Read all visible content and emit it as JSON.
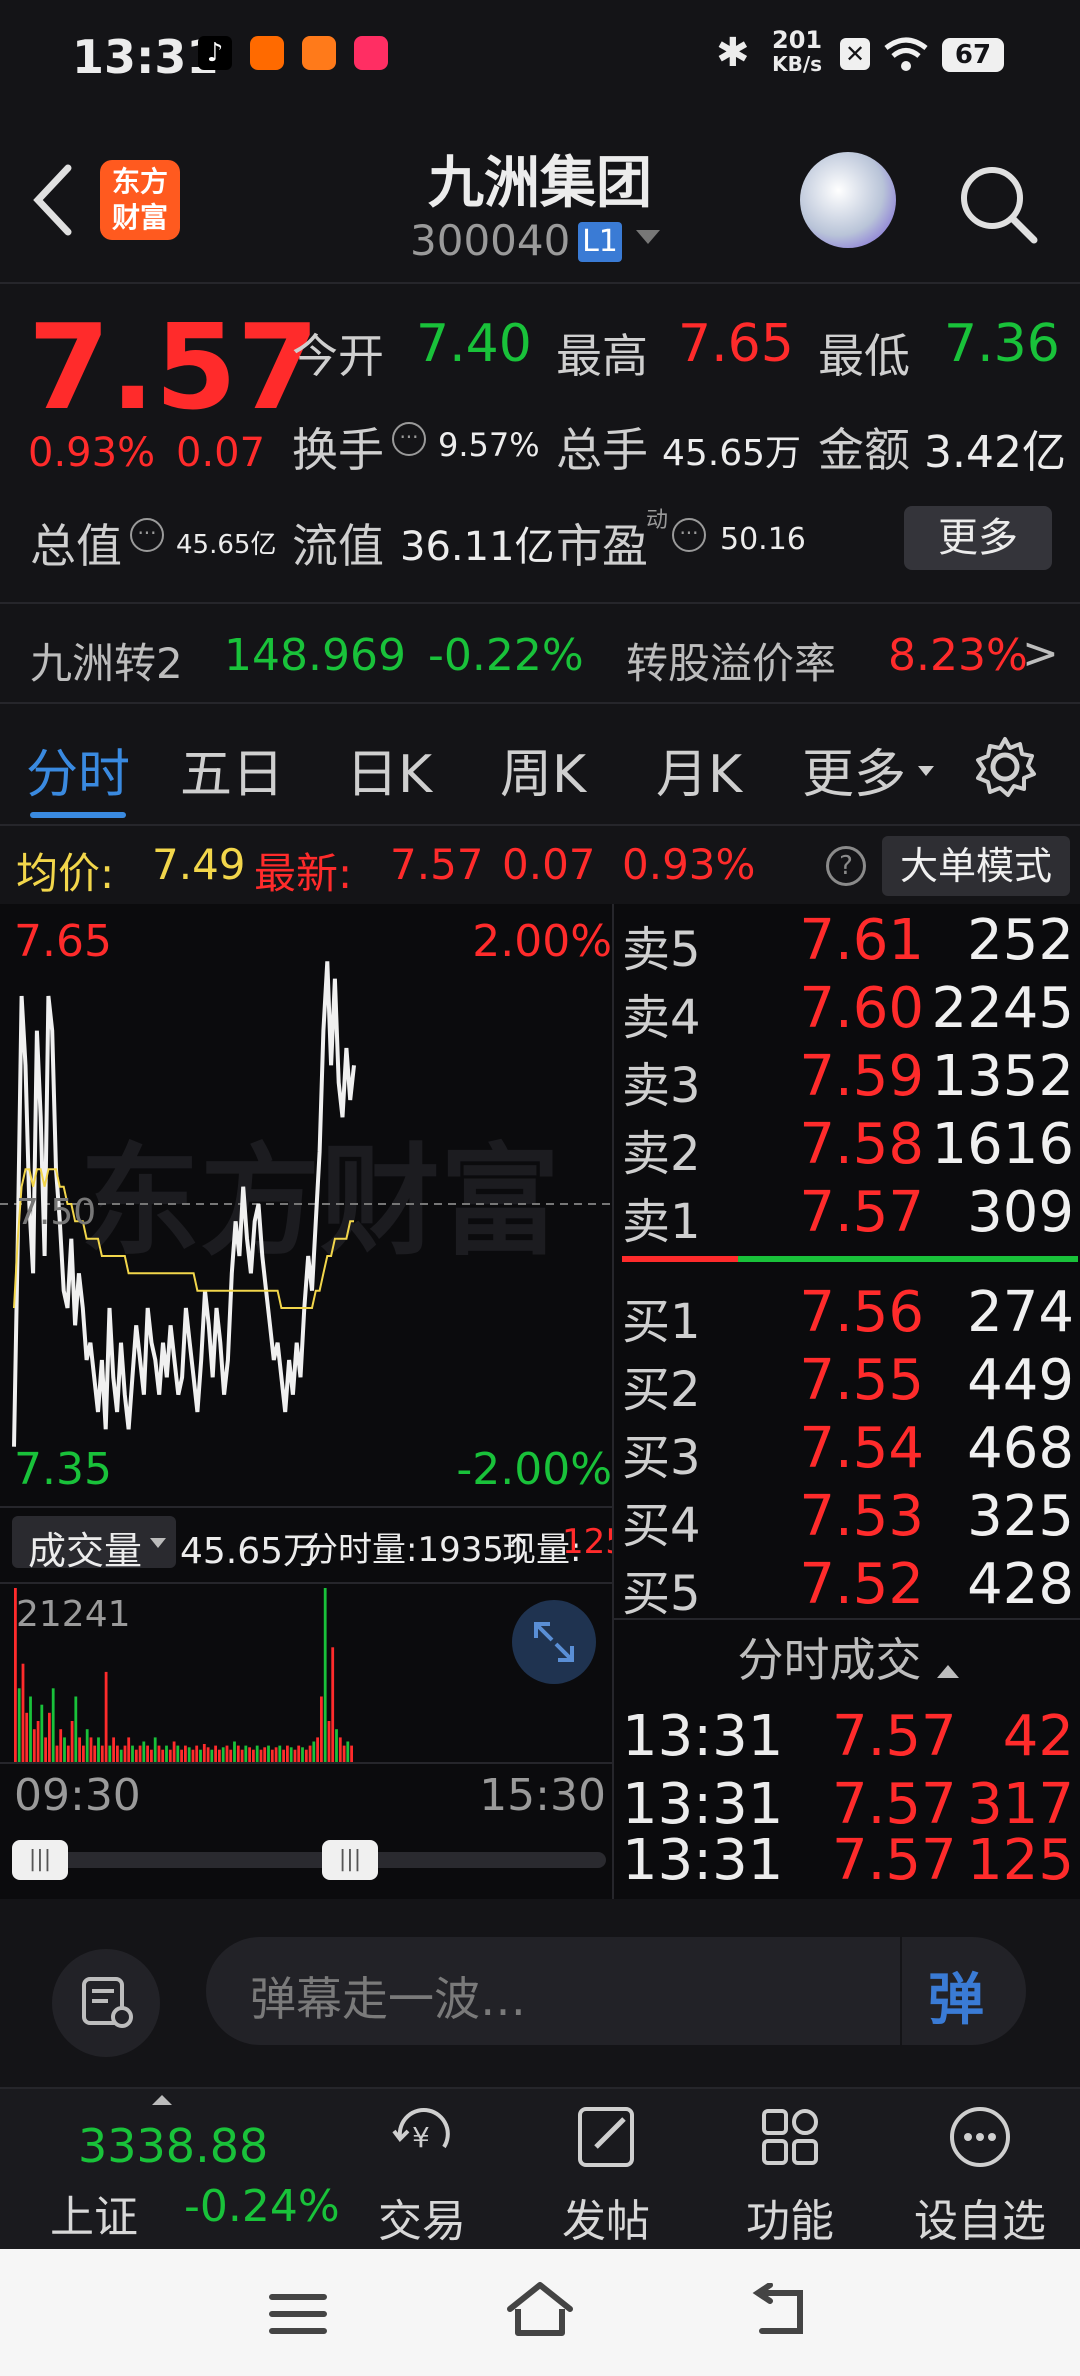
{
  "status": {
    "time": "13:31",
    "net_speed_value": "201",
    "net_speed_unit": "KB/s",
    "battery": "67"
  },
  "header": {
    "logo_line1": "东方",
    "logo_line2": "财富",
    "title": "九洲集团",
    "code": "300040",
    "level_badge": "L1"
  },
  "quote": {
    "price": "7.57",
    "change_pct": "0.93%",
    "change": "0.07",
    "open_label": "今开",
    "open": "7.40",
    "high_label": "最高",
    "high": "7.65",
    "low_label": "最低",
    "low": "7.36",
    "turnover_label": "换手",
    "turnover": "9.57%",
    "volume_label": "总手",
    "volume": "45.65万",
    "amount_label": "金额",
    "amount": "3.42亿",
    "mktcap_label": "总值",
    "mktcap": "45.65亿",
    "float_label": "流值",
    "float": "36.11亿",
    "pe_label": "市盈",
    "pe_sup": "动",
    "pe": "50.16",
    "more_button": "更多"
  },
  "convertible": {
    "name": "九洲转2",
    "price": "148.969",
    "change_pct": "-0.22%",
    "premium_label": "转股溢价率",
    "premium": "8.23%",
    "arrow": ">"
  },
  "tabs": [
    {
      "label": "分时"
    },
    {
      "label": "五日"
    },
    {
      "label": "日K"
    },
    {
      "label": "周K"
    },
    {
      "label": "月K"
    },
    {
      "label": "更多"
    }
  ],
  "avg_bar": {
    "avg_label": "均价:",
    "avg": "7.49",
    "latest_label": "最新:",
    "latest": "7.57",
    "change": "0.07",
    "change_pct": "0.93%",
    "help": "?",
    "big_order_button": "大单模式"
  },
  "chart": {
    "price_high": "7.65",
    "price_low": "7.35",
    "pct_high": "2.00%",
    "pct_low": "-2.00%",
    "mid_label": "7.50",
    "watermark": "东方财富",
    "volume_select": "成交量",
    "volume_total": "45.65万",
    "tick_volume": "分时量:1935↑",
    "current_vol_label": "现量:",
    "current_vol": "125",
    "vol_max": "21241",
    "time_start": "09:30",
    "time_end": "15:30"
  },
  "chart_data": {
    "type": "line",
    "ylim": [
      7.35,
      7.65
    ],
    "prev_close": 7.5,
    "series": [
      {
        "values": [
          7.36,
          7.48,
          7.62,
          7.58,
          7.5,
          7.46,
          7.6,
          7.55,
          7.47,
          7.62,
          7.6,
          7.52,
          7.49,
          7.45,
          7.44,
          7.48,
          7.43,
          7.46,
          7.44,
          7.41,
          7.42,
          7.4,
          7.38,
          7.41,
          7.37,
          7.44,
          7.4,
          7.38,
          7.42,
          7.39,
          7.37,
          7.4,
          7.43,
          7.41,
          7.39,
          7.44,
          7.42,
          7.41,
          7.39,
          7.42,
          7.4,
          7.43,
          7.41,
          7.39,
          7.4,
          7.44,
          7.42,
          7.4,
          7.38,
          7.41,
          7.45,
          7.43,
          7.4,
          7.44,
          7.42,
          7.39,
          7.41,
          7.46,
          7.49,
          7.47,
          7.51,
          7.48,
          7.46,
          7.49,
          7.5,
          7.47,
          7.45,
          7.43,
          7.41,
          7.42,
          7.4,
          7.38,
          7.41,
          7.39,
          7.42,
          7.4,
          7.44,
          7.47,
          7.45,
          7.49,
          7.53,
          7.6,
          7.64,
          7.58,
          7.63,
          7.57,
          7.55,
          7.59,
          7.56,
          7.58
        ]
      },
      {
        "values": [
          7.44,
          7.48,
          7.51,
          7.52,
          7.52,
          7.51,
          7.52,
          7.52,
          7.51,
          7.52,
          7.52,
          7.52,
          7.51,
          7.51,
          7.5,
          7.5,
          7.49,
          7.49,
          7.49,
          7.48,
          7.48,
          7.48,
          7.48,
          7.47,
          7.47,
          7.47,
          7.47,
          7.47,
          7.47,
          7.47,
          7.46,
          7.46,
          7.46,
          7.46,
          7.46,
          7.46,
          7.46,
          7.46,
          7.46,
          7.46,
          7.46,
          7.46,
          7.46,
          7.46,
          7.46,
          7.46,
          7.46,
          7.46,
          7.45,
          7.45,
          7.45,
          7.45,
          7.45,
          7.45,
          7.45,
          7.45,
          7.45,
          7.45,
          7.45,
          7.45,
          7.45,
          7.45,
          7.45,
          7.45,
          7.45,
          7.45,
          7.45,
          7.45,
          7.45,
          7.45,
          7.44,
          7.44,
          7.44,
          7.44,
          7.44,
          7.44,
          7.44,
          7.44,
          7.44,
          7.45,
          7.45,
          7.46,
          7.47,
          7.47,
          7.48,
          7.48,
          7.48,
          7.48,
          7.49,
          7.49
        ]
      }
    ],
    "volume": [
      21241,
      9000,
      12000,
      6000,
      8000,
      4000,
      5000,
      7000,
      3000,
      6000,
      9000,
      2000,
      4000,
      3000,
      2000,
      5000,
      8000,
      3000,
      2000,
      4000,
      3000,
      2000,
      3000,
      2000,
      11000,
      2000,
      3000,
      2000,
      1500,
      2000,
      3000,
      2000,
      1500,
      2000,
      2500,
      2000,
      1500,
      3000,
      2000,
      1500,
      2000,
      1500,
      2500,
      2000,
      1500,
      2000,
      1800,
      1500,
      2000,
      1500,
      2200,
      1800,
      1500,
      2000,
      1500,
      1800,
      2000,
      1500,
      2500,
      2000,
      1500,
      2000,
      1800,
      1500,
      2000,
      1500,
      1800,
      2000,
      1500,
      1800,
      2000,
      1500,
      2000,
      1800,
      1500,
      2000,
      1800,
      1500,
      2000,
      2500,
      3000,
      8000,
      21241,
      5000,
      14000,
      4000,
      3000,
      2000,
      2500,
      2000
    ],
    "volume_colors": "r-g"
  },
  "order_book": {
    "asks": [
      {
        "label": "卖5",
        "price": "7.61",
        "vol": "252"
      },
      {
        "label": "卖4",
        "price": "7.60",
        "vol": "2245"
      },
      {
        "label": "卖3",
        "price": "7.59",
        "vol": "1352"
      },
      {
        "label": "卖2",
        "price": "7.58",
        "vol": "1616"
      },
      {
        "label": "卖1",
        "price": "7.57",
        "vol": "309"
      }
    ],
    "bids": [
      {
        "label": "买1",
        "price": "7.56",
        "vol": "274"
      },
      {
        "label": "买2",
        "price": "7.55",
        "vol": "449"
      },
      {
        "label": "买3",
        "price": "7.54",
        "vol": "468"
      },
      {
        "label": "买4",
        "price": "7.53",
        "vol": "325"
      },
      {
        "label": "买5",
        "price": "7.52",
        "vol": "428"
      }
    ],
    "ticks_title": "分时成交",
    "ticks": [
      {
        "time": "13:31",
        "price": "7.57",
        "vol": "42"
      },
      {
        "time": "13:31",
        "price": "7.57",
        "vol": "317"
      },
      {
        "time": "13:31",
        "price": "7.57",
        "vol": "125"
      }
    ]
  },
  "danmu": {
    "placeholder": "弹幕走一波…",
    "send_label": "弹"
  },
  "bottom_nav": {
    "index_value": "3338.88",
    "index_name": "上证",
    "index_change": "-0.24%",
    "items": [
      {
        "label": "交易"
      },
      {
        "label": "发帖"
      },
      {
        "label": "功能"
      },
      {
        "label": "设自选"
      }
    ]
  },
  "colors": {
    "up": "#ff2b2b",
    "down": "#19c23a",
    "avg_line": "#f2d64b",
    "accent": "#3a7bd5",
    "bg": "#141417"
  }
}
